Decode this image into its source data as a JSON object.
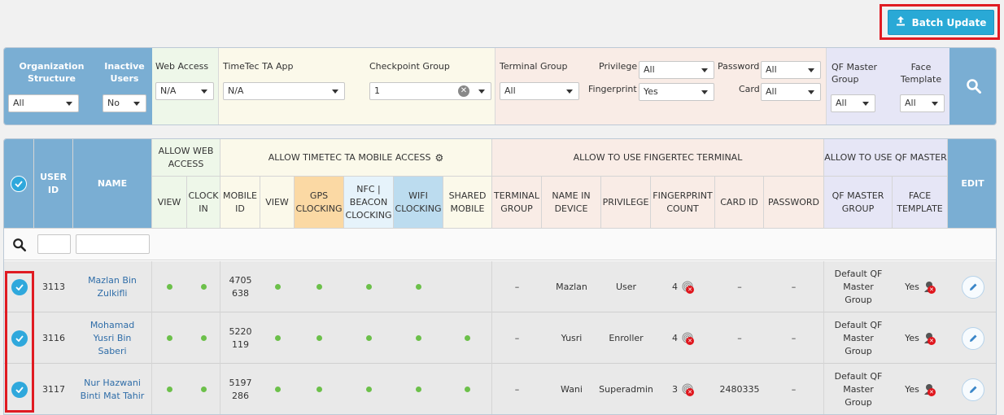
{
  "toolbar": {
    "batch_update_label": "Batch Update"
  },
  "filters": {
    "org_structure_label": "Organization Structure",
    "org_structure_value": "All",
    "inactive_users_label": "Inactive Users",
    "inactive_users_value": "No",
    "web_access_label": "Web Access",
    "web_access_value": "N/A",
    "ta_app_label": "TimeTec TA App",
    "ta_app_value": "N/A",
    "checkpoint_group_label": "Checkpoint Group",
    "checkpoint_group_value": "1",
    "terminal_group_label": "Terminal Group",
    "terminal_group_value": "All",
    "privilege_label": "Privilege",
    "privilege_value": "All",
    "fingerprint_label": "Fingerprint",
    "fingerprint_value": "Yes",
    "password_label": "Password",
    "password_value": "All",
    "card_label": "Card",
    "card_value": "All",
    "qf_master_group_label": "QF Master Group",
    "qf_master_group_value": "All",
    "face_template_label": "Face Template",
    "face_template_value": "All"
  },
  "table": {
    "headers": {
      "user_id": "USER ID",
      "name": "NAME",
      "allow_web_access": "ALLOW WEB ACCESS",
      "allow_mobile": "ALLOW TIMETEC TA MOBILE ACCESS",
      "allow_fingertec": "ALLOW TO USE FINGERTEC TERMINAL",
      "allow_qf": "ALLOW TO USE QF MASTER",
      "edit": "EDIT",
      "view": "VIEW",
      "clock_in": "CLOCK IN",
      "mobile_id": "MOBILE ID",
      "view2": "VIEW",
      "gps": "GPS CLOCKING",
      "nfc": "NFC | BEACON CLOCKING",
      "wifi": "WIFI CLOCKING",
      "shared": "SHARED MOBILE",
      "terminal_group": "TERMINAL GROUP",
      "name_in_device": "NAME IN DEVICE",
      "privilege": "PRIVILEGE",
      "fp_count": "FINGERPRINT COUNT",
      "card_id": "CARD ID",
      "password": "PASSWORD",
      "qf_master_group": "QF MASTER GROUP",
      "face_template": "FACE TEMPLATE"
    },
    "rows": [
      {
        "user_id": "3113",
        "name": "Mazlan Bin Zulkifli",
        "mobile_id": "4705638",
        "shared": false,
        "terminal_group": "–",
        "name_in_device": "Mazlan",
        "privilege": "User",
        "fp_count": "4",
        "card_id": "–",
        "password": "–",
        "qf_group": "Default QF Master Group",
        "face": "Yes"
      },
      {
        "user_id": "3116",
        "name": "Mohamad Yusri Bin Saberi",
        "mobile_id": "5220119",
        "shared": true,
        "terminal_group": "–",
        "name_in_device": "Yusri",
        "privilege": "Enroller",
        "fp_count": "4",
        "card_id": "–",
        "password": "–",
        "qf_group": "Default QF Master Group",
        "face": "Yes"
      },
      {
        "user_id": "3117",
        "name": "Nur Hazwani Binti Mat Tahir",
        "mobile_id": "5197286",
        "shared": true,
        "terminal_group": "–",
        "name_in_device": "Wani",
        "privilege": "Superadmin",
        "fp_count": "3",
        "card_id": "2480335",
        "password": "–",
        "qf_group": "Default QF Master Group",
        "face": "Yes"
      }
    ]
  },
  "colors": {
    "accent": "#29a9d6",
    "highlight": "#e01b22",
    "status_dot": "#6cc04a"
  }
}
